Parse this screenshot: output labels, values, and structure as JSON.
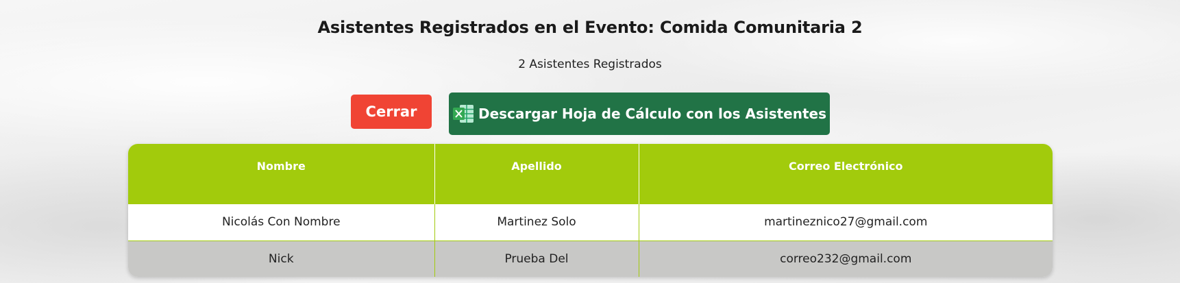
{
  "page": {
    "title": "Asistentes Registrados en el Evento: Comida Comunitaria 2",
    "count_text": "2 Asistentes Registrados"
  },
  "actions": {
    "close_label": "Cerrar",
    "download_label": "Descargar Hoja de Cálculo con los Asistentes",
    "download_icon": "excel-icon"
  },
  "table": {
    "headers": [
      "Nombre",
      "Apellido",
      "Correo Electrónico"
    ],
    "rows": [
      {
        "nombre": "Nicolás Con Nombre",
        "apellido": "Martinez Solo",
        "correo": "martineznico27@gmail.com"
      },
      {
        "nombre": "Nick",
        "apellido": "Prueba Del",
        "correo": "correo232@gmail.com"
      }
    ]
  },
  "colors": {
    "close_button": "#f04434",
    "download_button": "#217346",
    "table_header": "#a2cb0c",
    "alt_row": "#c8c8c6"
  }
}
